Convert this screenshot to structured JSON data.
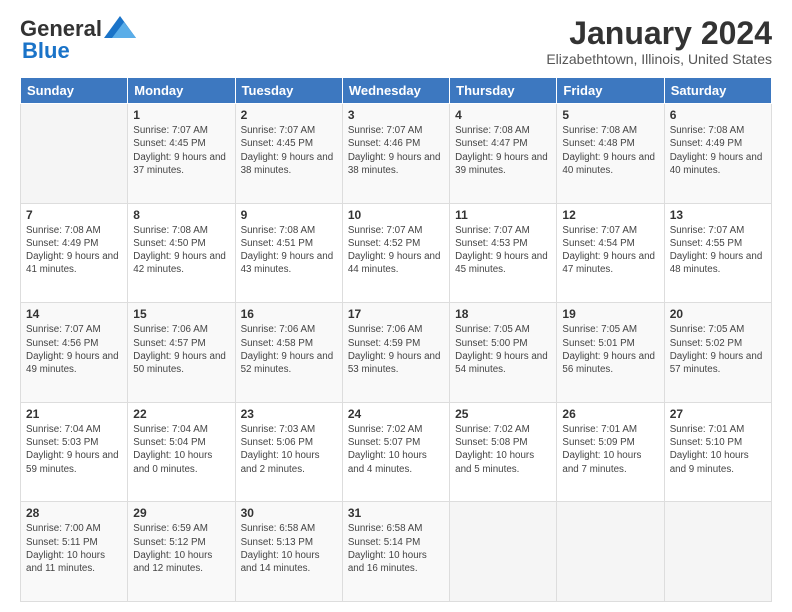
{
  "logo": {
    "line1": "General",
    "line2": "Blue"
  },
  "title": "January 2024",
  "subtitle": "Elizabethtown, Illinois, United States",
  "weekdays": [
    "Sunday",
    "Monday",
    "Tuesday",
    "Wednesday",
    "Thursday",
    "Friday",
    "Saturday"
  ],
  "weeks": [
    [
      {
        "day": "",
        "sunrise": "",
        "sunset": "",
        "daylight": ""
      },
      {
        "day": "1",
        "sunrise": "Sunrise: 7:07 AM",
        "sunset": "Sunset: 4:45 PM",
        "daylight": "Daylight: 9 hours and 37 minutes."
      },
      {
        "day": "2",
        "sunrise": "Sunrise: 7:07 AM",
        "sunset": "Sunset: 4:45 PM",
        "daylight": "Daylight: 9 hours and 38 minutes."
      },
      {
        "day": "3",
        "sunrise": "Sunrise: 7:07 AM",
        "sunset": "Sunset: 4:46 PM",
        "daylight": "Daylight: 9 hours and 38 minutes."
      },
      {
        "day": "4",
        "sunrise": "Sunrise: 7:08 AM",
        "sunset": "Sunset: 4:47 PM",
        "daylight": "Daylight: 9 hours and 39 minutes."
      },
      {
        "day": "5",
        "sunrise": "Sunrise: 7:08 AM",
        "sunset": "Sunset: 4:48 PM",
        "daylight": "Daylight: 9 hours and 40 minutes."
      },
      {
        "day": "6",
        "sunrise": "Sunrise: 7:08 AM",
        "sunset": "Sunset: 4:49 PM",
        "daylight": "Daylight: 9 hours and 40 minutes."
      }
    ],
    [
      {
        "day": "7",
        "sunrise": "Sunrise: 7:08 AM",
        "sunset": "Sunset: 4:49 PM",
        "daylight": "Daylight: 9 hours and 41 minutes."
      },
      {
        "day": "8",
        "sunrise": "Sunrise: 7:08 AM",
        "sunset": "Sunset: 4:50 PM",
        "daylight": "Daylight: 9 hours and 42 minutes."
      },
      {
        "day": "9",
        "sunrise": "Sunrise: 7:08 AM",
        "sunset": "Sunset: 4:51 PM",
        "daylight": "Daylight: 9 hours and 43 minutes."
      },
      {
        "day": "10",
        "sunrise": "Sunrise: 7:07 AM",
        "sunset": "Sunset: 4:52 PM",
        "daylight": "Daylight: 9 hours and 44 minutes."
      },
      {
        "day": "11",
        "sunrise": "Sunrise: 7:07 AM",
        "sunset": "Sunset: 4:53 PM",
        "daylight": "Daylight: 9 hours and 45 minutes."
      },
      {
        "day": "12",
        "sunrise": "Sunrise: 7:07 AM",
        "sunset": "Sunset: 4:54 PM",
        "daylight": "Daylight: 9 hours and 47 minutes."
      },
      {
        "day": "13",
        "sunrise": "Sunrise: 7:07 AM",
        "sunset": "Sunset: 4:55 PM",
        "daylight": "Daylight: 9 hours and 48 minutes."
      }
    ],
    [
      {
        "day": "14",
        "sunrise": "Sunrise: 7:07 AM",
        "sunset": "Sunset: 4:56 PM",
        "daylight": "Daylight: 9 hours and 49 minutes."
      },
      {
        "day": "15",
        "sunrise": "Sunrise: 7:06 AM",
        "sunset": "Sunset: 4:57 PM",
        "daylight": "Daylight: 9 hours and 50 minutes."
      },
      {
        "day": "16",
        "sunrise": "Sunrise: 7:06 AM",
        "sunset": "Sunset: 4:58 PM",
        "daylight": "Daylight: 9 hours and 52 minutes."
      },
      {
        "day": "17",
        "sunrise": "Sunrise: 7:06 AM",
        "sunset": "Sunset: 4:59 PM",
        "daylight": "Daylight: 9 hours and 53 minutes."
      },
      {
        "day": "18",
        "sunrise": "Sunrise: 7:05 AM",
        "sunset": "Sunset: 5:00 PM",
        "daylight": "Daylight: 9 hours and 54 minutes."
      },
      {
        "day": "19",
        "sunrise": "Sunrise: 7:05 AM",
        "sunset": "Sunset: 5:01 PM",
        "daylight": "Daylight: 9 hours and 56 minutes."
      },
      {
        "day": "20",
        "sunrise": "Sunrise: 7:05 AM",
        "sunset": "Sunset: 5:02 PM",
        "daylight": "Daylight: 9 hours and 57 minutes."
      }
    ],
    [
      {
        "day": "21",
        "sunrise": "Sunrise: 7:04 AM",
        "sunset": "Sunset: 5:03 PM",
        "daylight": "Daylight: 9 hours and 59 minutes."
      },
      {
        "day": "22",
        "sunrise": "Sunrise: 7:04 AM",
        "sunset": "Sunset: 5:04 PM",
        "daylight": "Daylight: 10 hours and 0 minutes."
      },
      {
        "day": "23",
        "sunrise": "Sunrise: 7:03 AM",
        "sunset": "Sunset: 5:06 PM",
        "daylight": "Daylight: 10 hours and 2 minutes."
      },
      {
        "day": "24",
        "sunrise": "Sunrise: 7:02 AM",
        "sunset": "Sunset: 5:07 PM",
        "daylight": "Daylight: 10 hours and 4 minutes."
      },
      {
        "day": "25",
        "sunrise": "Sunrise: 7:02 AM",
        "sunset": "Sunset: 5:08 PM",
        "daylight": "Daylight: 10 hours and 5 minutes."
      },
      {
        "day": "26",
        "sunrise": "Sunrise: 7:01 AM",
        "sunset": "Sunset: 5:09 PM",
        "daylight": "Daylight: 10 hours and 7 minutes."
      },
      {
        "day": "27",
        "sunrise": "Sunrise: 7:01 AM",
        "sunset": "Sunset: 5:10 PM",
        "daylight": "Daylight: 10 hours and 9 minutes."
      }
    ],
    [
      {
        "day": "28",
        "sunrise": "Sunrise: 7:00 AM",
        "sunset": "Sunset: 5:11 PM",
        "daylight": "Daylight: 10 hours and 11 minutes."
      },
      {
        "day": "29",
        "sunrise": "Sunrise: 6:59 AM",
        "sunset": "Sunset: 5:12 PM",
        "daylight": "Daylight: 10 hours and 12 minutes."
      },
      {
        "day": "30",
        "sunrise": "Sunrise: 6:58 AM",
        "sunset": "Sunset: 5:13 PM",
        "daylight": "Daylight: 10 hours and 14 minutes."
      },
      {
        "day": "31",
        "sunrise": "Sunrise: 6:58 AM",
        "sunset": "Sunset: 5:14 PM",
        "daylight": "Daylight: 10 hours and 16 minutes."
      },
      {
        "day": "",
        "sunrise": "",
        "sunset": "",
        "daylight": ""
      },
      {
        "day": "",
        "sunrise": "",
        "sunset": "",
        "daylight": ""
      },
      {
        "day": "",
        "sunrise": "",
        "sunset": "",
        "daylight": ""
      }
    ]
  ]
}
